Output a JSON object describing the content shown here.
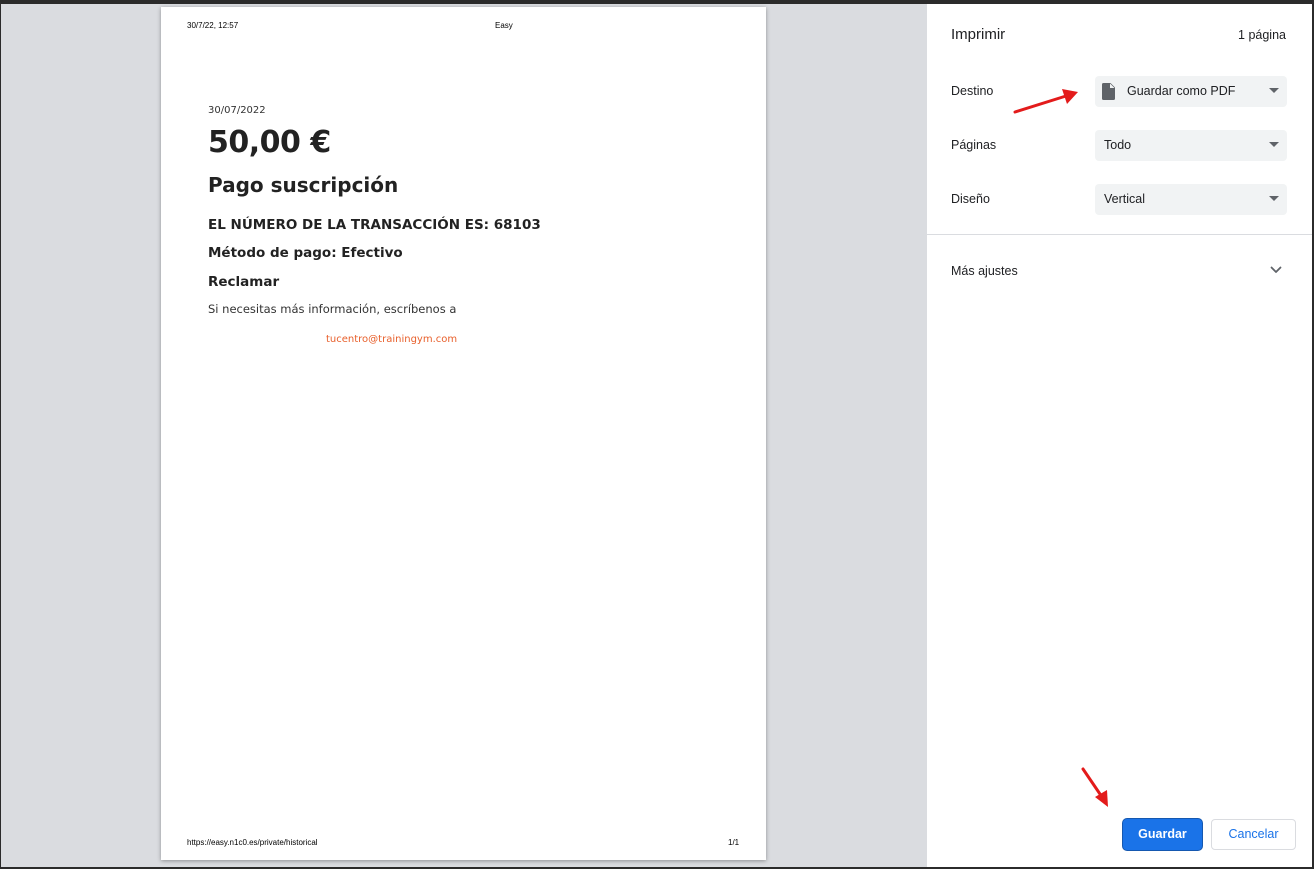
{
  "preview": {
    "header": {
      "datetime": "30/7/22, 12:57",
      "title": "Easy"
    },
    "footer": {
      "url": "https://easy.n1c0.es/private/historical",
      "page": "1/1"
    },
    "receipt": {
      "date": "30/07/2022",
      "amount": "50,00 €",
      "concept": "Pago suscripción",
      "transaction": "EL NÚMERO DE LA TRANSACCIÓN ES: 68103",
      "payment_method": "Método de pago: Efectivo",
      "claim_title": "Reclamar",
      "claim_text": "Si necesitas más información, escríbenos a",
      "email": "tucentro@trainingym.com",
      "email_color": "#e8602c"
    }
  },
  "sidebar": {
    "title": "Imprimir",
    "page_count": "1 página",
    "destination": {
      "label": "Destino",
      "value": "Guardar como PDF",
      "icon": "file-icon"
    },
    "pages": {
      "label": "Páginas",
      "value": "Todo"
    },
    "layout": {
      "label": "Diseño",
      "value": "Vertical"
    },
    "more_settings": {
      "label": "Más ajustes",
      "icon": "chevron-down-icon"
    },
    "save_button": "Guardar",
    "cancel_button": "Cancelar",
    "accent_color": "#1a73e8"
  },
  "annotations": {
    "arrow_color": "#e31b1b"
  }
}
